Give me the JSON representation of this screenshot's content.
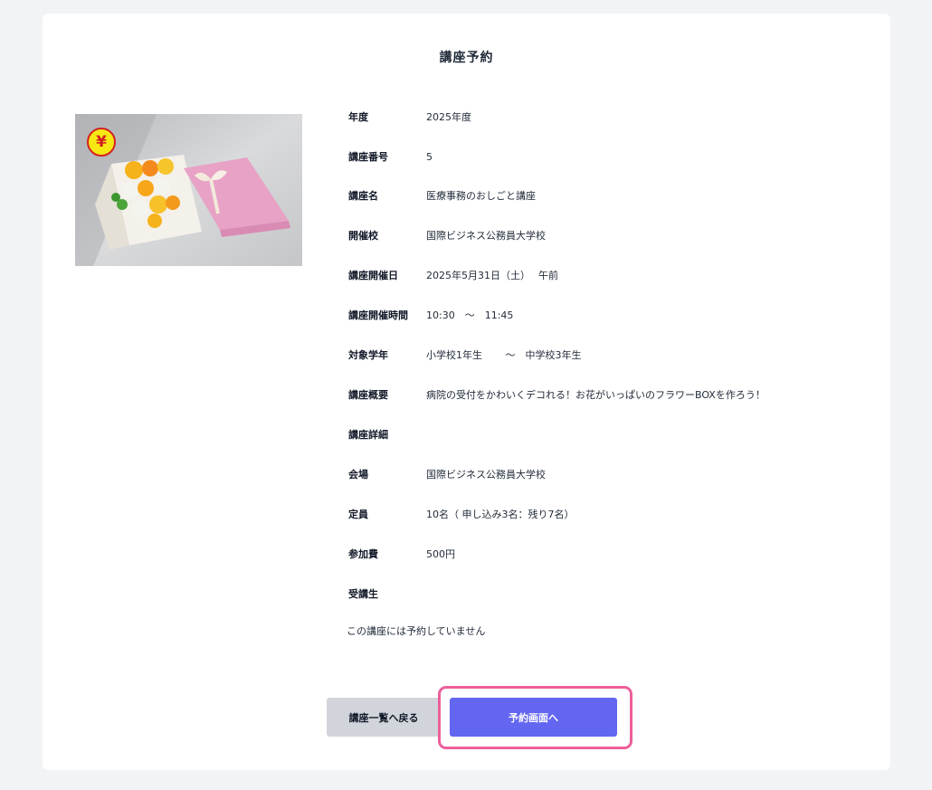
{
  "page": {
    "title": "講座予約"
  },
  "details": [
    {
      "label": "年度",
      "value": "2025年度"
    },
    {
      "label": "講座番号",
      "value": "5"
    },
    {
      "label": "講座名",
      "value": "医療事務のおしごと講座"
    },
    {
      "label": "開催校",
      "value": "国際ビジネス公務員大学校"
    },
    {
      "label": "講座開催日",
      "value": "2025年5月31日（土）　 午前"
    },
    {
      "label": "講座開催時間",
      "value": "10:30　～　11:45"
    },
    {
      "label": "対象学年",
      "value": "小学校1年生　　 ～　中学校3年生"
    },
    {
      "label": "講座概要",
      "value": "病院の受付をかわいくデコれる！お花がいっぱいのフラワーBOXを作ろう！"
    },
    {
      "label": "講座詳細",
      "value": ""
    },
    {
      "label": "会場",
      "value": "国際ビジネス公務員大学校"
    },
    {
      "label": "定員",
      "value": "10名（ 申し込み3名：残り7名）"
    },
    {
      "label": "参加費",
      "value": "500円"
    },
    {
      "label": "受講生",
      "value": ""
    }
  ],
  "notice": "この講座には予約していません",
  "badge": {
    "symbol": "¥",
    "icon": "yen-icon"
  },
  "buttons": {
    "back": "講座一覧へ戻る",
    "reserve": "予約画面へ"
  },
  "colors": {
    "accent": "#6366f1",
    "highlight": "#ec5f9a",
    "badge": "#f7e814"
  }
}
